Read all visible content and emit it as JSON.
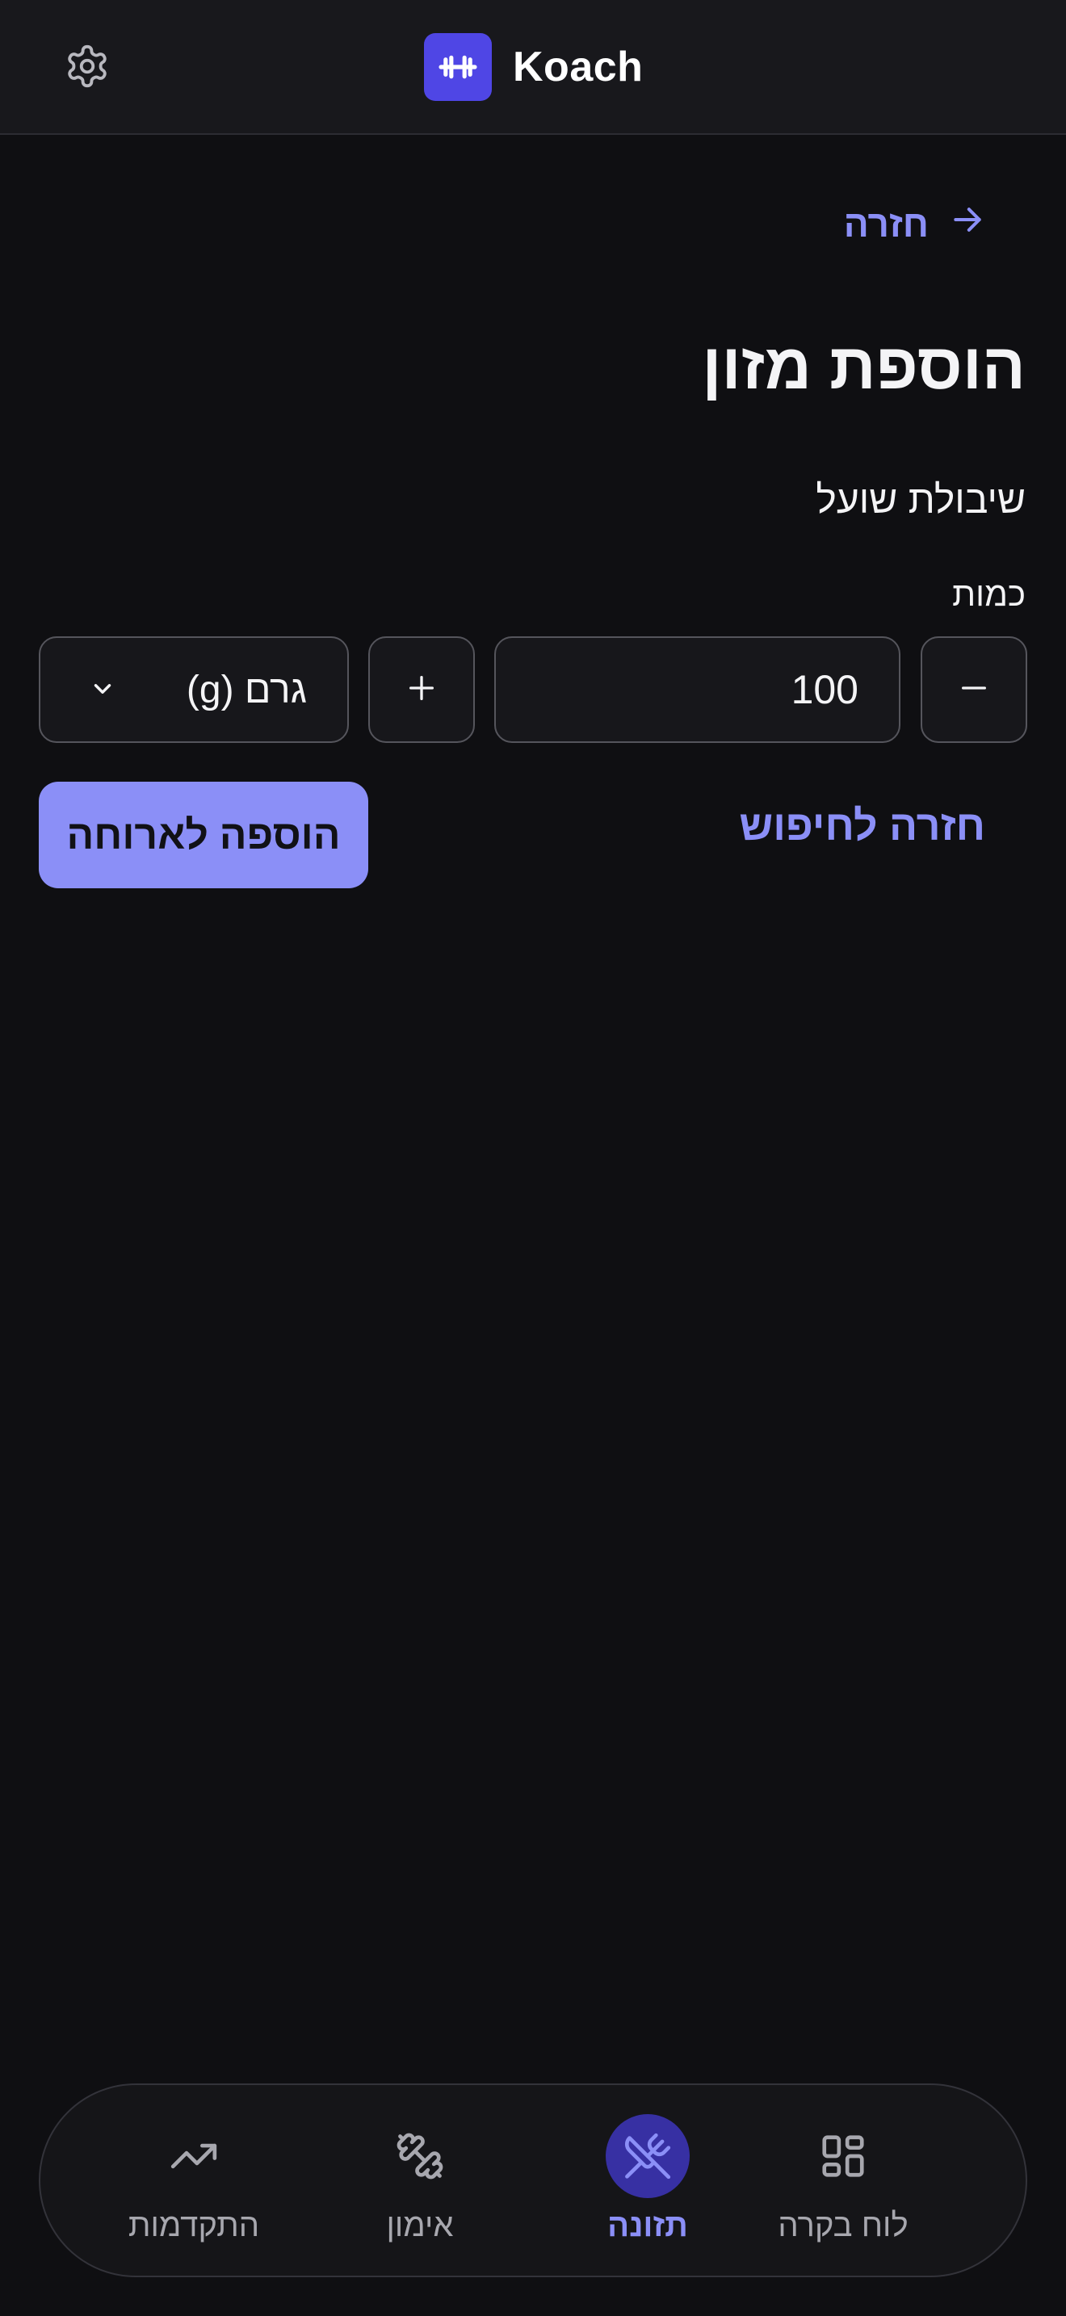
{
  "header": {
    "app_name": "Koach",
    "settings_icon": "gear-icon",
    "logo_icon": "dumbbell-icon",
    "accent": "#4f46e5"
  },
  "main": {
    "back_label": "חזרה",
    "back_icon": "arrow-right-icon",
    "title": "הוספת מזון",
    "food_name": "שיבולת שועל",
    "quantity_label": "כמות",
    "quantity_value": "100",
    "unit_selected": "גרם (g)",
    "back_to_search_label": "חזרה לחיפוש",
    "add_to_meal_label": "הוספה לארוחה",
    "primary_color": "#8b8ff7"
  },
  "nav": {
    "items": [
      {
        "label": "לוח בקרה",
        "icon": "dashboard-grid-icon",
        "active": false
      },
      {
        "label": "תזונה",
        "icon": "fork-knife-icon",
        "active": true
      },
      {
        "label": "אימון",
        "icon": "dumbbell-icon",
        "active": false
      },
      {
        "label": "התקדמות",
        "icon": "trending-up-icon",
        "active": false
      }
    ]
  }
}
